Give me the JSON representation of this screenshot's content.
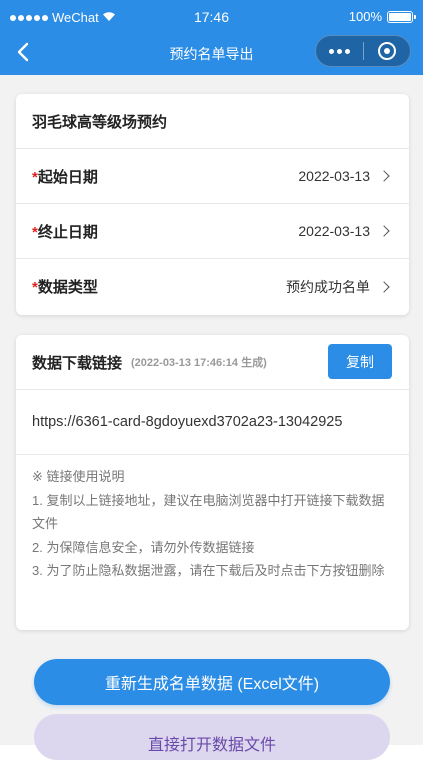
{
  "status_bar": {
    "carrier": "WeChat",
    "time": "17:46",
    "battery": "100%"
  },
  "nav": {
    "title": "预约名单导出"
  },
  "form": {
    "title": "羽毛球高等级场预约",
    "rows": [
      {
        "label": "起始日期",
        "value": "2022-03-13"
      },
      {
        "label": "终止日期",
        "value": "2022-03-13"
      },
      {
        "label": "数据类型",
        "value": "预约成功名单"
      }
    ],
    "required_mark": "*"
  },
  "download": {
    "title": "数据下载链接",
    "generated_note": "(2022-03-13 17:46:14 生成)",
    "copy_label": "复制",
    "link": "https://6361-card-8gdoyuexd3702a23-13042925",
    "notes": [
      "※ 链接使用说明",
      "1. 复制以上链接地址，建议在电脑浏览器中打开链接下载数据文件",
      "2. 为保障信息安全，请勿外传数据链接",
      "3. 为了防止隐私数据泄露，请在下载后及时点击下方按钮删除"
    ]
  },
  "actions": {
    "regenerate_label": "重新生成名单数据 (Excel文件)",
    "open_label": "直接打开数据文件"
  },
  "colors": {
    "accent": "#2b8de6",
    "required": "#e02020",
    "secondary_bg": "#dcd6ef",
    "secondary_text": "#6a4aa8"
  }
}
